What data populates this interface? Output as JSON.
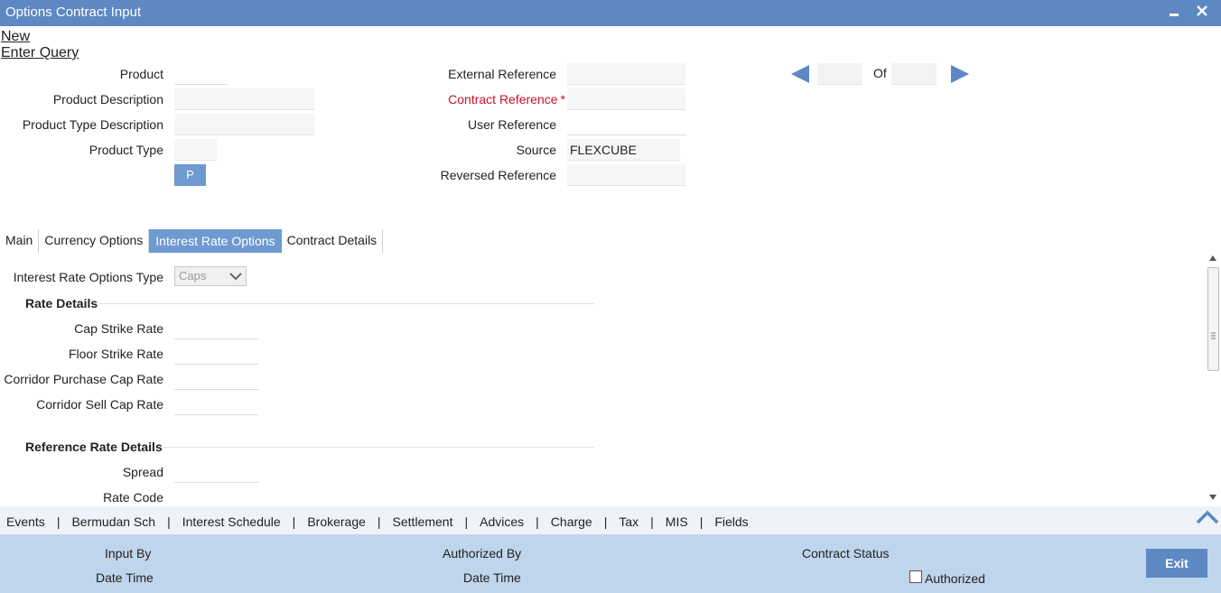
{
  "window": {
    "title": "Options Contract Input",
    "minimize_icon": "minimize-icon",
    "close_icon": "close-icon"
  },
  "menu": {
    "new": "New",
    "enter_query": "Enter Query"
  },
  "header": {
    "product_label": "Product",
    "product_description_label": "Product Description",
    "product_type_description_label": "Product Type Description",
    "product_type_label": "Product Type",
    "p_button": "P",
    "external_reference_label": "External Reference",
    "contract_reference_label": "Contract Reference",
    "required_marker": "*",
    "user_reference_label": "User Reference",
    "source_label": "Source",
    "source_value": "FLEXCUBE",
    "reversed_reference_label": "Reversed Reference",
    "of_label": "Of",
    "prev_icon": "arrow-left-icon",
    "next_icon": "arrow-right-icon"
  },
  "tabs": [
    {
      "label": "Main",
      "active": false
    },
    {
      "label": "Currency Options",
      "active": false
    },
    {
      "label": "Interest Rate Options",
      "active": true
    },
    {
      "label": "Contract Details",
      "active": false
    }
  ],
  "interest_rate_options": {
    "type_label": "Interest Rate Options Type",
    "type_value": "Caps",
    "rate_details_heading": "Rate Details",
    "cap_strike_rate_label": "Cap Strike Rate",
    "floor_strike_rate_label": "Floor Strike Rate",
    "corridor_purchase_cap_rate_label": "Corridor Purchase Cap Rate",
    "corridor_sell_cap_rate_label": "Corridor Sell Cap Rate",
    "reference_rate_details_heading": "Reference Rate Details",
    "spread_label": "Spread",
    "rate_code_label": "Rate Code"
  },
  "bottom_links": [
    "Events",
    "Bermudan Sch",
    "Interest Schedule",
    "Brokerage",
    "Settlement",
    "Advices",
    "Charge",
    "Tax",
    "MIS",
    "Fields"
  ],
  "bottom_separator": "|",
  "footer": {
    "input_by_label": "Input By",
    "date_time_label_1": "Date Time",
    "authorized_by_label": "Authorized By",
    "date_time_label_2": "Date Time",
    "contract_status_label": "Contract Status",
    "authorized_label": "Authorized",
    "authorized_checked": false,
    "exit_button": "Exit"
  },
  "colors": {
    "title_bar": "#5d88c3",
    "active_tab": "#6f99d1",
    "required_text": "#c8102e",
    "footer_bg": "#bfd5eb",
    "bottom_links_bg": "#eef3f9"
  }
}
